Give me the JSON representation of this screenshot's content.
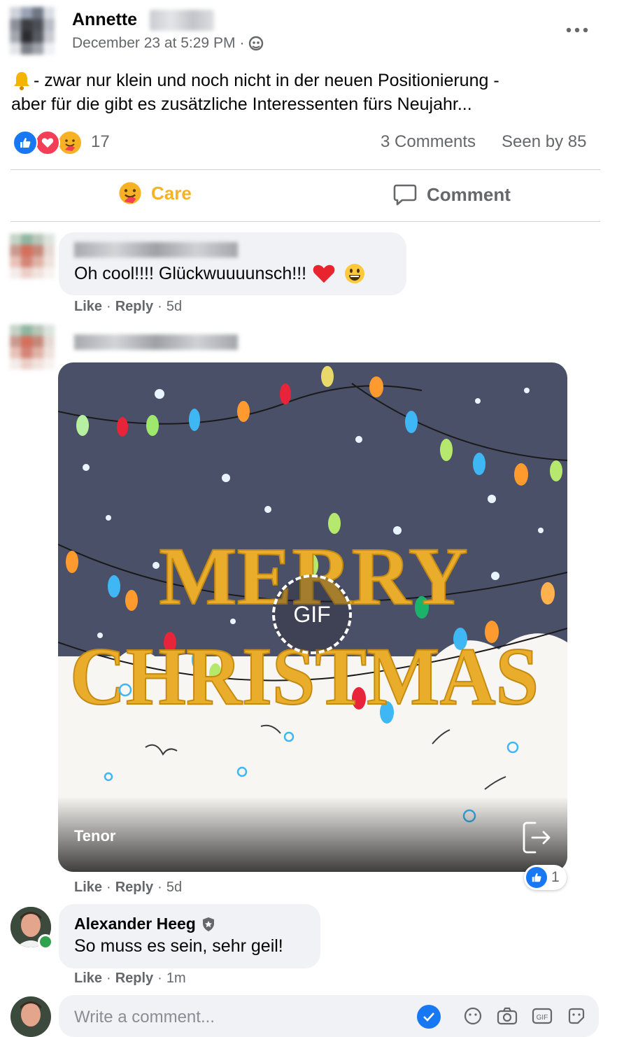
{
  "post": {
    "author": "Annette",
    "timestamp": "December 23 at 5:29 PM",
    "privacy_separator": "·",
    "body_line1": "- zwar nur klein und noch nicht in der neuen Positionierung -",
    "body_line2": "aber für die gibt es zusätzliche Interessenten fürs Neujahr...",
    "reactions_count": "17",
    "comments_count": "3 Comments",
    "seen_by": "Seen by 85"
  },
  "actions": {
    "care_label": "Care",
    "comment_label": "Comment"
  },
  "comments": [
    {
      "text": "Oh cool!!!! Glückwuuuunsch!!!",
      "like": "Like",
      "reply": "Reply",
      "time": "5d"
    },
    {
      "gif_badge": "GIF",
      "gif_source": "Tenor",
      "gif_text_line1": "MERRY",
      "gif_text_line2": "CHRISTMAS",
      "like": "Like",
      "reply": "Reply",
      "time": "5d",
      "reaction_count": "1"
    },
    {
      "author": "Alexander Heeg",
      "text": "So muss es sein, sehr geil!",
      "like": "Like",
      "reply": "Reply",
      "time": "1m"
    }
  ],
  "composer": {
    "placeholder": "Write a comment..."
  },
  "colors": {
    "accent_blue": "#1877f2",
    "care_orange": "#f7b125",
    "like_red": "#f33e58",
    "gif_bg": "#4a5068"
  },
  "icons": [
    "more-icon",
    "privacy-icon",
    "bell-icon",
    "like-reaction-icon",
    "love-reaction-icon",
    "care-reaction-icon",
    "comment-icon",
    "heart-emoji",
    "grin-emoji",
    "share-out-icon",
    "verified-icon",
    "send-icon",
    "emoji-icon",
    "camera-icon",
    "gif-icon",
    "sticker-icon"
  ]
}
